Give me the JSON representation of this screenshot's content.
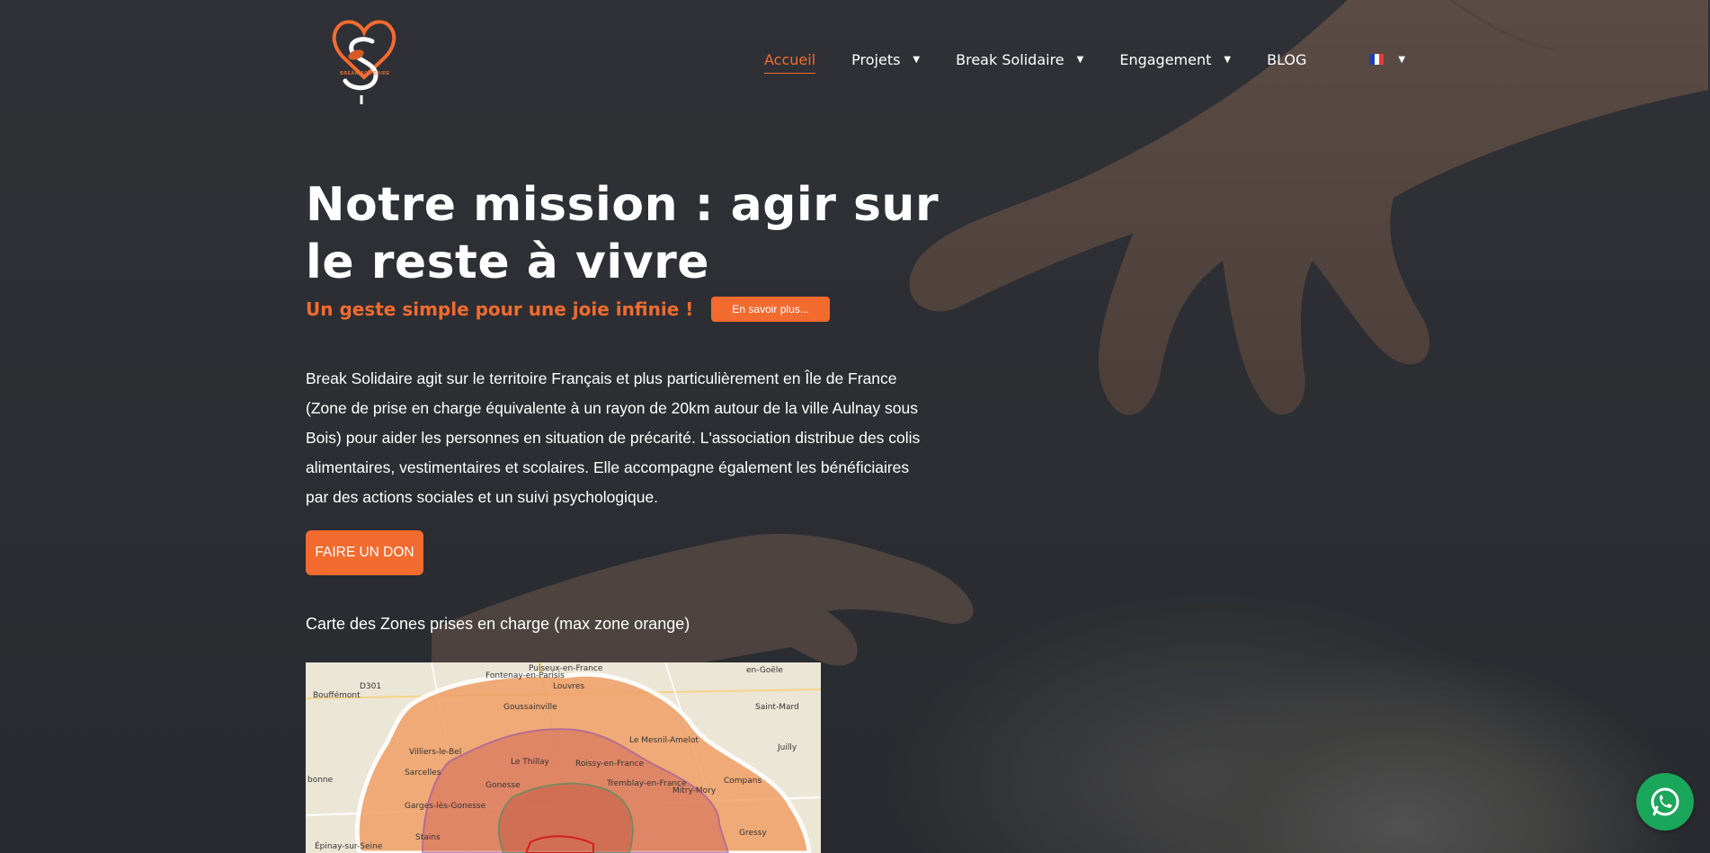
{
  "brand": {
    "logo_text": "BREAK SOLIDAIRE",
    "accent": "#f36b2f"
  },
  "nav": {
    "items": [
      {
        "label": "Accueil",
        "dropdown": false,
        "active": true
      },
      {
        "label": "Projets",
        "dropdown": true,
        "active": false
      },
      {
        "label": "Break Solidaire",
        "dropdown": true,
        "active": false
      },
      {
        "label": "Engagement",
        "dropdown": true,
        "active": false
      },
      {
        "label": "BLOG",
        "dropdown": false,
        "active": false
      }
    ],
    "language_icon": "french-flag-icon"
  },
  "hero": {
    "title": "Notre mission : agir sur le reste à vivre",
    "tagline": "Un geste simple pour une joie infinie !",
    "more_button": "En savoir plus...",
    "description": "Break Solidaire agit sur le territoire Français et plus particulièrement en Île de France (Zone de prise en charge équivalente à un rayon de 20km autour de la ville Aulnay sous Bois) pour aider les personnes en situation de précarité. L'association distribue des colis alimentaires, vestimentaires et scolaires. Elle accompagne également les bénéficiaires par des actions sociales et un suivi psychologique.",
    "donate_button": "FAIRE UN DON",
    "map_caption": "Carte des Zones prises en charge (max zone orange)"
  },
  "map": {
    "labels": [
      "Puiseux-en-France",
      "Fontenay-en-Parisis",
      "Louvres",
      "en-Goële",
      "Bouffémont",
      "D301",
      "Goussainville",
      "Saint-Mard",
      "Le Mesnil-Amelot",
      "Juilly",
      "Villiers-le-Bel",
      "Le Thillay",
      "Roissy-en-France",
      "Sarcelles",
      "Gonesse",
      "Tremblay-en-France",
      "Mitry-Mory",
      "Compans",
      "Garges-lès-Gonesse",
      "Stains",
      "Gressy",
      "Épinay-sur-Seine",
      "bonne"
    ]
  },
  "widgets": {
    "whatsapp_icon": "whatsapp-icon"
  }
}
